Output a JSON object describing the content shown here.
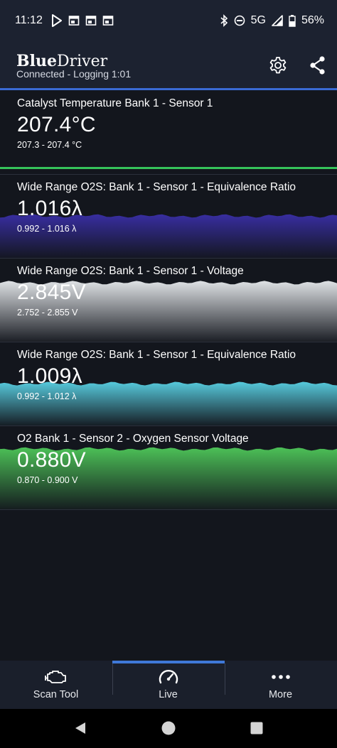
{
  "status_bar": {
    "time": "11:12",
    "network": "5G",
    "battery": "56%",
    "icons_left": [
      "play-store-icon",
      "app-window-icon",
      "app-window-icon",
      "app-window-icon"
    ],
    "icons_right": [
      "bluetooth-icon",
      "do-not-disturb-icon",
      "signal-icon",
      "battery-icon"
    ]
  },
  "app_bar": {
    "brand_bold": "Blue",
    "brand_regular": "Driver",
    "subtitle": "Connected - Logging 1:01",
    "actions": [
      "gear-icon",
      "share-icon"
    ]
  },
  "tiles": [
    {
      "label": "Catalyst Temperature Bank 1 - Sensor 1",
      "value": "207.4°C",
      "range": "207.3 - 207.4 °C",
      "color": "#35c35a",
      "fill_level": 0.0
    },
    {
      "label": "Wide Range O2S: Bank 1 - Sensor 1 - Equivalence Ratio",
      "value": "1.016λ",
      "range": "0.992 - 1.016 λ",
      "color": "#3a2fa8",
      "fill_level": 0.5
    },
    {
      "label": "Wide Range O2S: Bank 1 - Sensor 1 - Voltage",
      "value": "2.845V",
      "range": "2.752 - 2.855 V",
      "color": "#e9ecef",
      "fill_level": 0.7
    },
    {
      "label": "Wide Range O2S: Bank 1 - Sensor 1 - Equivalence Ratio",
      "value": "1.009λ",
      "range": "0.992 - 1.012 λ",
      "color": "#5ad3e6",
      "fill_level": 0.5
    },
    {
      "label": "O2 Bank 1 - Sensor 2 - Oxygen Sensor Voltage",
      "value": "0.880V",
      "range": "0.870 - 0.900 V",
      "color": "#4fc95a",
      "fill_level": 0.72
    }
  ],
  "bottom_nav": {
    "items": [
      {
        "label": "Scan Tool",
        "icon": "engine-icon",
        "active": false
      },
      {
        "label": "Live",
        "icon": "gauge-icon",
        "active": true
      },
      {
        "label": "More",
        "icon": "more-dots-icon",
        "active": false
      }
    ]
  },
  "system_nav": [
    "back-icon",
    "home-icon",
    "recents-icon"
  ]
}
